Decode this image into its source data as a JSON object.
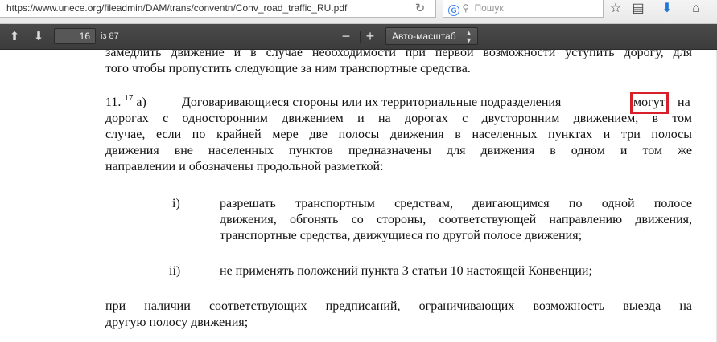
{
  "browser": {
    "url": "https://www.unece.org/fileadmin/DAM/trans/conventn/Conv_road_traffic_RU.pdf",
    "search_placeholder": "Пошук",
    "search_engine_glyph": "G",
    "icons": [
      "reload-icon",
      "search-icon",
      "star-icon",
      "reading-list-icon",
      "download-icon",
      "home-icon"
    ]
  },
  "pdf_toolbar": {
    "up": "⬆",
    "down": "⬇",
    "page_number": "16",
    "page_count": "із 87",
    "zoom_out": "−",
    "zoom_in": "+",
    "zoom_value": "Авто-масштаб",
    "zoom_caret": "▲▼"
  },
  "document": {
    "line0": "замедлить движение и в случае необходимости при первой возможности уступить дорогу, для",
    "line1": "того чтобы пропустить следующие за ним транспортные средства.",
    "p11_num": "11.",
    "p11_sup": "17",
    "p11_a": "а)",
    "p11_first_before": "Договаривающиеся стороны или их территориальные подразделения",
    "p11_highlight": "могут",
    "p11_first_after": "на",
    "p11_line2": "дорогах с односторонним движением и на дорогах с двусторонним движением, в том",
    "p11_line3": "случае, если по крайней мере две полосы движения в населенных пунктах и три полосы",
    "p11_line4": "движения вне населенных пунктов предназначены для движения в одном и том же",
    "p11_line5": "направлении и обозначены продольной разметкой:",
    "i_label": "i)",
    "i_line1": "разрешать транспортным средствам, двигающимся по одной полосе",
    "i_line2": "движения, обгонять со стороны, соответствующей направлению движения,",
    "i_line3": "транспортные средства, движущиеся по другой полосе движения;",
    "ii_label": "ii)",
    "ii_line1": "не применять положений пункта 3 статьи 10 настоящей Конвенции;",
    "last_line1": "при наличии соответствующих предписаний, ограничивающих возможность выезда на",
    "last_line2": "другую полосу движения;"
  },
  "colors": {
    "highlight": "#d8202a",
    "pdf_toolbar": "#444444"
  }
}
